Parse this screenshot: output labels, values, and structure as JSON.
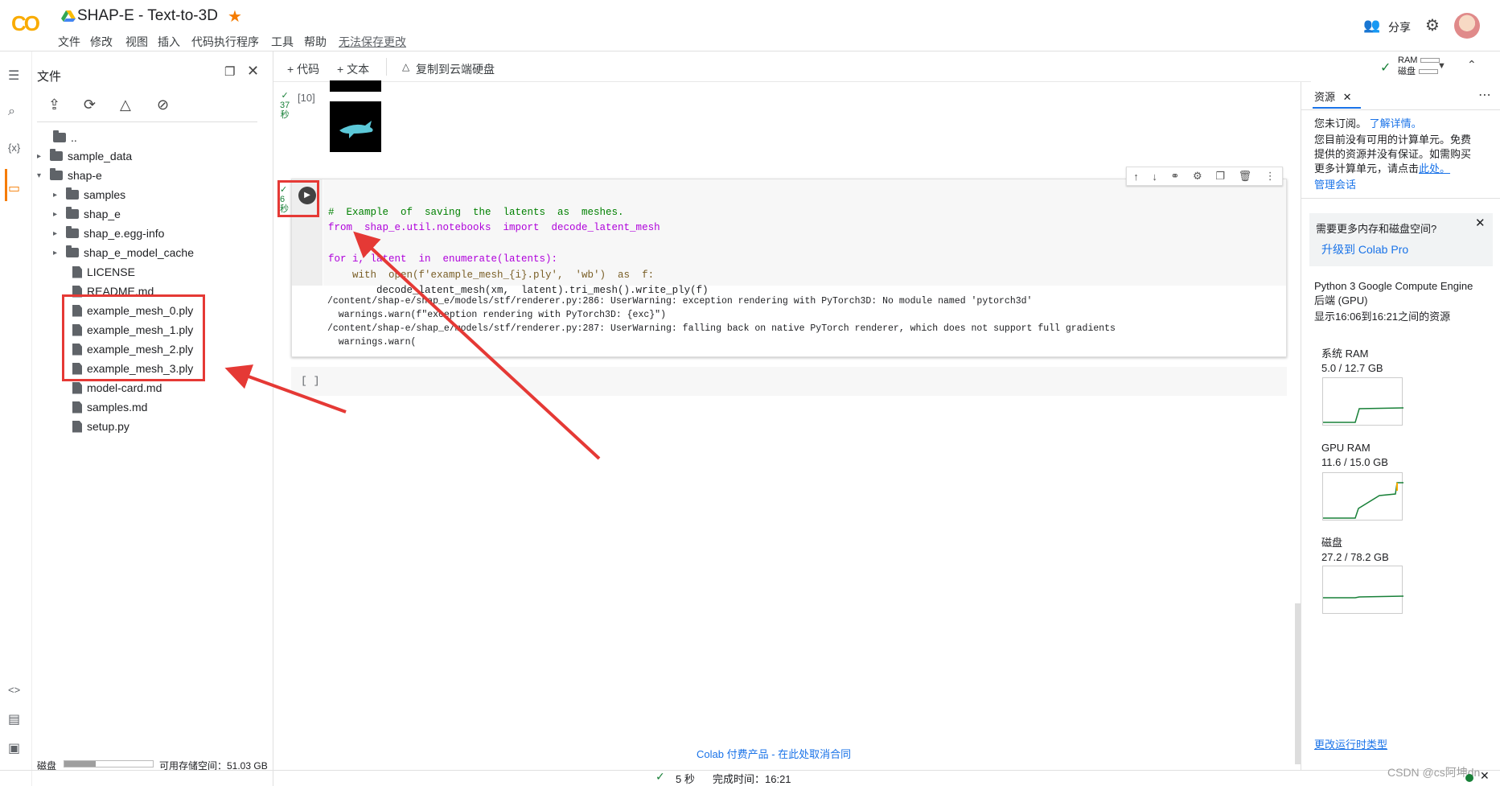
{
  "app": {
    "logo": "CO",
    "title": "SHAP-E - Text-to-3D"
  },
  "menu": [
    "文件",
    "修改",
    "视图",
    "插入",
    "代码执行程序",
    "工具",
    "帮助"
  ],
  "menu_unsaved": "无法保存更改",
  "header": {
    "share": "分享"
  },
  "left_panel": {
    "title": "文件",
    "tree": [
      {
        "label": "..",
        "type": "up"
      },
      {
        "label": "sample_data",
        "type": "folder",
        "caret": "▸"
      },
      {
        "label": "shap-e",
        "type": "folder",
        "caret": "▾"
      },
      {
        "label": "samples",
        "type": "folder",
        "caret": "▸"
      },
      {
        "label": "shap_e",
        "type": "folder",
        "caret": "▸"
      },
      {
        "label": "shap_e.egg-info",
        "type": "folder",
        "caret": "▸"
      },
      {
        "label": "shap_e_model_cache",
        "type": "folder",
        "caret": "▸"
      },
      {
        "label": "LICENSE",
        "type": "file"
      },
      {
        "label": "README.md",
        "type": "file"
      },
      {
        "label": "example_mesh_0.ply",
        "type": "file"
      },
      {
        "label": "example_mesh_1.ply",
        "type": "file"
      },
      {
        "label": "example_mesh_2.ply",
        "type": "file"
      },
      {
        "label": "example_mesh_3.ply",
        "type": "file"
      },
      {
        "label": "model-card.md",
        "type": "file"
      },
      {
        "label": "samples.md",
        "type": "file"
      },
      {
        "label": "setup.py",
        "type": "file"
      }
    ],
    "disk_label": "磁盘",
    "disk_fraction": 0.35,
    "disk_available": "可用存储空间：51.03 GB"
  },
  "toolbar": {
    "add_code": "+ 代码",
    "add_text": "+ 文本",
    "copy_drive": "复制到云端硬盘",
    "ram": "RAM",
    "disk": "磁盘"
  },
  "cell10": {
    "label": "[10]",
    "time_num": "37",
    "time_unit": "秒"
  },
  "code_cell": {
    "time_num": "6",
    "time_unit": "秒",
    "lines": [
      "#  Example  of  saving  the  latents  as  meshes.",
      "from  shap_e.util.notebooks  import  decode_latent_mesh",
      "",
      "for i, latent  in  enumerate(latents):",
      "    with  open(f'example_mesh_{i}.ply',  'wb')  as  f:",
      "        decode_latent_mesh(xm,  latent).tri_mesh().write_ply(f)"
    ],
    "output": [
      "/content/shap-e/shap_e/models/stf/renderer.py:286: UserWarning: exception rendering with PyTorch3D: No module named 'pytorch3d'",
      "  warnings.warn(f\"exception rendering with PyTorch3D: {exc}\")",
      "/content/shap-e/shap_e/models/stf/renderer.py:287: UserWarning: falling back on native PyTorch renderer, which does not support full gradients",
      "  warnings.warn("
    ]
  },
  "empty_cell": "[ ]",
  "footer_promo": {
    "products": "Colab 付费产品",
    "sep": " - ",
    "cancel": "在此处取消合同"
  },
  "resources": {
    "tab": "资源",
    "not_subscribed": "您未订阅。",
    "learn_more": "了解详情。",
    "desc1": "您目前没有可用的计算单元。免费",
    "desc2": "提供的资源并没有保证。如需购买",
    "desc3": "更多计算单元，请点击",
    "here": "此处。",
    "manage": "管理会话",
    "upsell_q": "需要更多内存和磁盘空间?",
    "upsell_link": "升级到 Colab Pro",
    "engine1": "Python 3 Google Compute Engine",
    "engine2": "后端 (GPU)",
    "period": "显示16:06到16:21之间的资源",
    "metrics": [
      {
        "name": "系统 RAM",
        "value": "5.0 / 12.7 GB",
        "color": "#188038"
      },
      {
        "name": "GPU RAM",
        "value": "11.6 / 15.0 GB",
        "color": "#188038"
      },
      {
        "name": "磁盘",
        "value": "27.2 / 78.2 GB",
        "color": "#188038"
      }
    ],
    "change_runtime": "更改运行时类型"
  },
  "status": {
    "duration": "5 秒",
    "done": "完成时间：16:21"
  },
  "watermark": "CSDN @cs阿坤dn",
  "colors": {
    "accent": "#f9ab00",
    "annotation": "#e53935",
    "link": "#1a73e8",
    "ok": "#188038"
  }
}
